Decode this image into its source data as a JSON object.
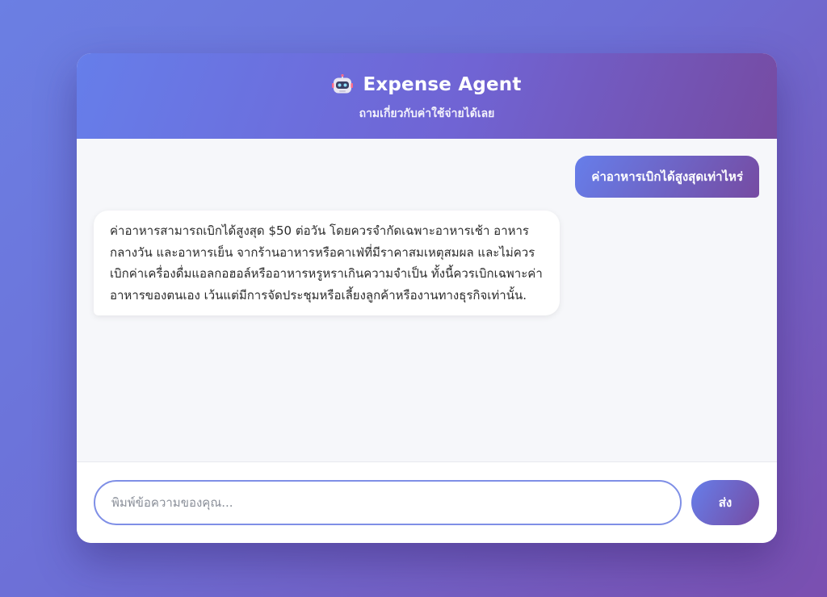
{
  "header": {
    "icon": "robot-icon",
    "title": "Expense Agent",
    "subtitle": "ถามเกี่ยวกับค่าใช้จ่ายได้เลย"
  },
  "messages": [
    {
      "role": "user",
      "text": "ค่าอาหารเบิกได้สูงสุดเท่าไหร่"
    },
    {
      "role": "bot",
      "text": "ค่าอาหารสามารถเบิกได้สูงสุด $50 ต่อวัน โดยควรจำกัดเฉพาะอาหารเช้า อาหารกลางวัน และอาหารเย็น จากร้านอาหารหรือคาเฟ่ที่มีราคาสมเหตุสมผล และไม่ควรเบิกค่าเครื่องดื่มแอลกอฮอล์หรืออาหารหรูหราเกินความจำเป็น ทั้งนี้ควรเบิกเฉพาะค่าอาหารของตนเอง เว้นแต่มีการจัดประชุมหรือเลี้ยงลูกค้าหรืองานทางธุรกิจเท่านั้น."
    }
  ],
  "input": {
    "placeholder": "พิมพ์ข้อความของคุณ...",
    "value": ""
  },
  "send_label": "ส่ง",
  "colors": {
    "accent_start": "#667eea",
    "accent_end": "#764ba2"
  }
}
